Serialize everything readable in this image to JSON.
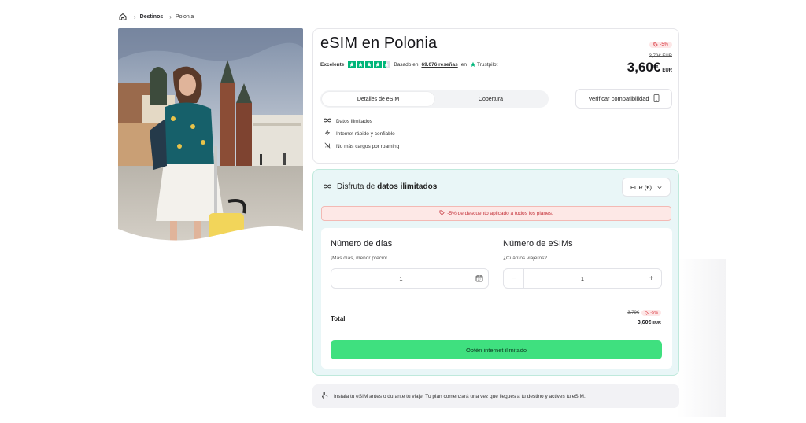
{
  "breadcrumb": {
    "items": [
      "Destinos",
      "Polonia"
    ]
  },
  "product": {
    "title": "eSIM en Polonia",
    "rating_word": "Excelente",
    "based_on": "Basado en",
    "reviews": "69.076 reseñas",
    "on": "en",
    "trustpilot": "Trustpilot",
    "stars": 4.5
  },
  "price": {
    "discount_badge": "-5%",
    "old_price": "3,79€ EUR",
    "new_price": "3,60€",
    "currency": "EUR"
  },
  "tabs": [
    {
      "label": "Detalles de eSIM",
      "active": true
    },
    {
      "label": "Cobertura",
      "active": false
    }
  ],
  "verify_button": "Verificar compatibilidad",
  "features": [
    {
      "icon": "infinity-icon",
      "label": "Datos ilimitados"
    },
    {
      "icon": "bolt-icon",
      "label": "Internet rápido y confiable"
    },
    {
      "icon": "no-signal-icon",
      "label": "No más cargos por roaming"
    }
  ],
  "plan": {
    "heading_prefix": "Disfruta de",
    "heading_bold": "datos ilimitados",
    "currency_select": "EUR (€)",
    "promo": "-5% de descuento aplicado a todos los planes.",
    "days": {
      "title": "Número de días",
      "subtitle": "¡Más días, menor precio!",
      "value": "1"
    },
    "esims": {
      "title": "Número de eSIMs",
      "subtitle": "¿Cuántos viajeros?",
      "value": "1",
      "minus": "−",
      "plus": "+"
    },
    "total": {
      "label": "Total",
      "old_price": "3,79€",
      "badge": "-5%",
      "price": "3,60€",
      "currency": "EUR"
    },
    "cta": "Obtén internet ilimitado"
  },
  "install_note": "Instala tu eSIM antes o durante tu viaje. Tu plan comenzará una vez que llegues a tu destino y actives tu eSIM.",
  "colors": {
    "accent_green": "#3fe07f",
    "trustpilot_green": "#00b67a",
    "discount_red": "#d9363e",
    "panel_bg": "#e9f6f7"
  }
}
